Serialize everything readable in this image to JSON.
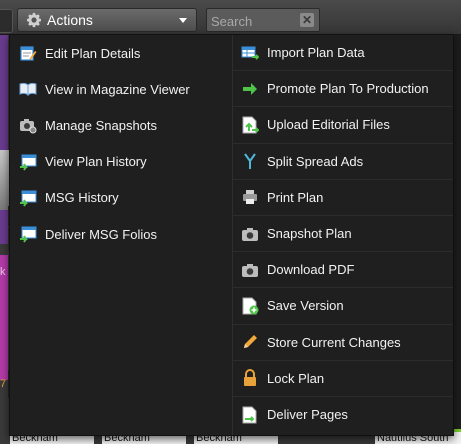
{
  "toolbar": {
    "actions_label": "Actions",
    "search_placeholder": "Search",
    "clear_symbol": "✕"
  },
  "menu": {
    "left": [
      {
        "label": "Edit Plan Details",
        "icon": "edit-plan-icon"
      },
      {
        "label": "View in Magazine Viewer",
        "icon": "book-icon"
      },
      {
        "label": "Manage Snapshots",
        "icon": "camera-gear-icon"
      },
      {
        "label": "View Plan History",
        "icon": "history-icon"
      },
      {
        "label": "MSG History",
        "icon": "msg-history-icon"
      },
      {
        "label": "Deliver MSG Folios",
        "icon": "deliver-folios-icon"
      }
    ],
    "right": [
      {
        "label": "Import Plan Data",
        "icon": "import-table-icon"
      },
      {
        "label": "Promote Plan To Production",
        "icon": "green-arrow-icon"
      },
      {
        "label": "Upload Editorial Files",
        "icon": "upload-file-icon"
      },
      {
        "label": "Split Spread Ads",
        "icon": "split-icon"
      },
      {
        "label": "Print Plan",
        "icon": "printer-icon"
      },
      {
        "label": "Snapshot Plan",
        "icon": "camera-icon"
      },
      {
        "label": "Download PDF",
        "icon": "camera-icon"
      },
      {
        "label": "Save Version",
        "icon": "save-version-icon"
      },
      {
        "label": "Store Current Changes",
        "icon": "pencil-icon"
      },
      {
        "label": "Lock Plan",
        "icon": "lock-icon"
      },
      {
        "label": "Deliver Pages",
        "icon": "deliver-pages-icon"
      }
    ]
  },
  "background": {
    "bottom_labels": [
      "Beckham",
      "Beckham",
      "Beckham",
      "Nautilus South"
    ],
    "left_edge_text_pink": "k",
    "left_edge_text_orange": "7"
  },
  "colors": {
    "menu_bg": "#1f1f1f",
    "accent_green": "#7cd12f",
    "lock_orange": "#e8a23a"
  }
}
